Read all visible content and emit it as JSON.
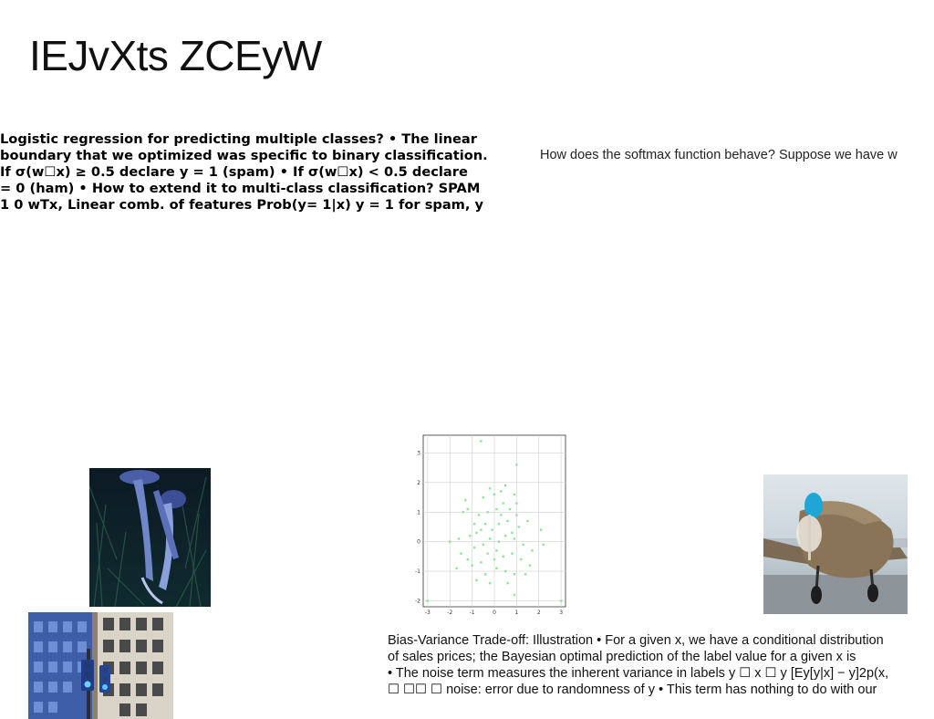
{
  "slide": {
    "title": "IEJvXts ZCEyW"
  },
  "bold_block": {
    "lines": [
      "Logistic regression for predicting multiple classes? • The linear",
      "boundary that we optimized was specific to binary classification.",
      "If σ(w☐x) ≥ 0.5 declare y = 1 (spam) • If σ(w☐x) < 0.5 declare",
      "= 0 (ham) • How to extend it to multi-class classification? SPAM",
      "1 0 wTx, Linear comb. of features Prob(y= 1|x) y = 1 for spam, y"
    ]
  },
  "softmax_text": "How does the softmax function behave? Suppose we have w",
  "bias_variance": {
    "lines": [
      "Bias-Variance Trade-off: Illustration • For a given x, we have a conditional distribution",
      "of sales prices; the Bayesian optimal prediction of the label value for a given x is",
      "• The noise term measures the inherent variance in labels y ☐ x ☐ y [Ey[y|x] − y]2p(x,",
      "☐ ☐☐ ☐ noise: error due to randomness of y • This term has nothing to do with our"
    ]
  },
  "images": {
    "mushroom": "mushroom-photo",
    "building": "building-with-traffic-light-photo",
    "airplane": "vintage-airplane-photo"
  },
  "chart_data": {
    "type": "scatter",
    "title": "",
    "xlabel": "",
    "ylabel": "",
    "xlim": [
      -3.2,
      3.2
    ],
    "ylim": [
      -2.2,
      3.6
    ],
    "x_ticks": [
      "-3",
      "-2",
      "-1",
      "0",
      "1",
      "2",
      "3"
    ],
    "y_ticks": [
      "-2",
      "-1",
      "0",
      "1",
      "2",
      "3"
    ],
    "grid": true,
    "point_color": "#8fe39a",
    "points": [
      [
        -0.6,
        3.4
      ],
      [
        1.0,
        2.6
      ],
      [
        -3.0,
        -2.0
      ],
      [
        3.0,
        -2.0
      ],
      [
        0.9,
        -1.8
      ],
      [
        -1.3,
        1.4
      ],
      [
        -1.2,
        1.1
      ],
      [
        -0.5,
        1.5
      ],
      [
        -0.2,
        1.8
      ],
      [
        0.0,
        1.6
      ],
      [
        0.3,
        1.7
      ],
      [
        0.5,
        1.9
      ],
      [
        0.9,
        1.6
      ],
      [
        1.0,
        1.3
      ],
      [
        0.7,
        1.1
      ],
      [
        0.4,
        1.3
      ],
      [
        0.1,
        1.1
      ],
      [
        -0.3,
        1.0
      ],
      [
        -0.7,
        0.9
      ],
      [
        -0.9,
        0.6
      ],
      [
        -1.6,
        0.1
      ],
      [
        -2.0,
        0.0
      ],
      [
        -1.1,
        0.2
      ],
      [
        -0.8,
        0.3
      ],
      [
        -0.4,
        0.6
      ],
      [
        -0.1,
        0.4
      ],
      [
        0.2,
        0.6
      ],
      [
        0.6,
        0.7
      ],
      [
        1.1,
        0.5
      ],
      [
        1.5,
        0.7
      ],
      [
        2.1,
        0.4
      ],
      [
        2.2,
        -0.1
      ],
      [
        1.7,
        -0.3
      ],
      [
        1.3,
        -0.1
      ],
      [
        0.9,
        0.1
      ],
      [
        0.5,
        0.2
      ],
      [
        0.2,
        0.0
      ],
      [
        -0.2,
        0.1
      ],
      [
        -0.5,
        -0.1
      ],
      [
        -0.9,
        -0.2
      ],
      [
        -1.2,
        -0.6
      ],
      [
        -1.0,
        -0.8
      ],
      [
        -0.6,
        -0.7
      ],
      [
        -0.3,
        -0.4
      ],
      [
        0.1,
        -0.3
      ],
      [
        0.4,
        -0.5
      ],
      [
        0.8,
        -0.4
      ],
      [
        1.2,
        -0.6
      ],
      [
        1.6,
        -0.8
      ],
      [
        1.4,
        -1.1
      ],
      [
        0.9,
        -1.1
      ],
      [
        0.5,
        -1.0
      ],
      [
        0.1,
        -0.9
      ],
      [
        -0.4,
        -1.1
      ],
      [
        -0.8,
        -1.3
      ],
      [
        -1.5,
        -0.4
      ],
      [
        -1.7,
        -0.9
      ],
      [
        -0.2,
        -1.4
      ],
      [
        0.6,
        -1.4
      ],
      [
        1.0,
        0.9
      ],
      [
        -0.6,
        0.4
      ],
      [
        0.3,
        0.9
      ],
      [
        0.8,
        0.3
      ],
      [
        -1.4,
        1.0
      ],
      [
        0.0,
        -0.6
      ]
    ]
  }
}
